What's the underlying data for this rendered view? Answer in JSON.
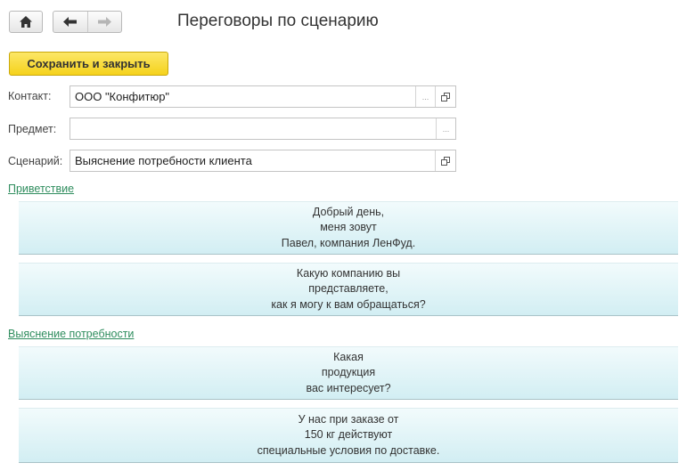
{
  "toolbar": {
    "home_icon": "home-icon",
    "back_icon": "arrow-left-icon",
    "forward_icon": "arrow-right-icon"
  },
  "form": {
    "title": "Переговоры по сценарию",
    "save_label": "Сохранить и закрыть"
  },
  "fields": {
    "contact": {
      "label": "Контакт:",
      "value": "ООО \"Конфитюр\""
    },
    "subject": {
      "label": "Предмет:",
      "value": ""
    },
    "scenario": {
      "label": "Сценарий:",
      "value": "Выяснение потребности клиента"
    },
    "select_button": "...",
    "open_icon": "open-window-icon"
  },
  "sections": [
    {
      "title": "Приветствие",
      "phrases": [
        [
          "Добрый день,",
          "меня зовут",
          "Павел, компания ЛенФуд."
        ],
        [
          "Какую компанию вы",
          "представляете,",
          "как я могу к вам обращаться?"
        ]
      ]
    },
    {
      "title": "Выяснение потребности",
      "phrases": [
        [
          "Какая",
          "продукция",
          "вас интересует?"
        ],
        [
          "У нас при заказе от",
          "150 кг действуют",
          "специальные условия по доставке."
        ]
      ]
    }
  ],
  "colors": {
    "save_button": "#f5d21c",
    "section_link": "#2f8d5e",
    "phrase_background": "#d2eef3"
  }
}
